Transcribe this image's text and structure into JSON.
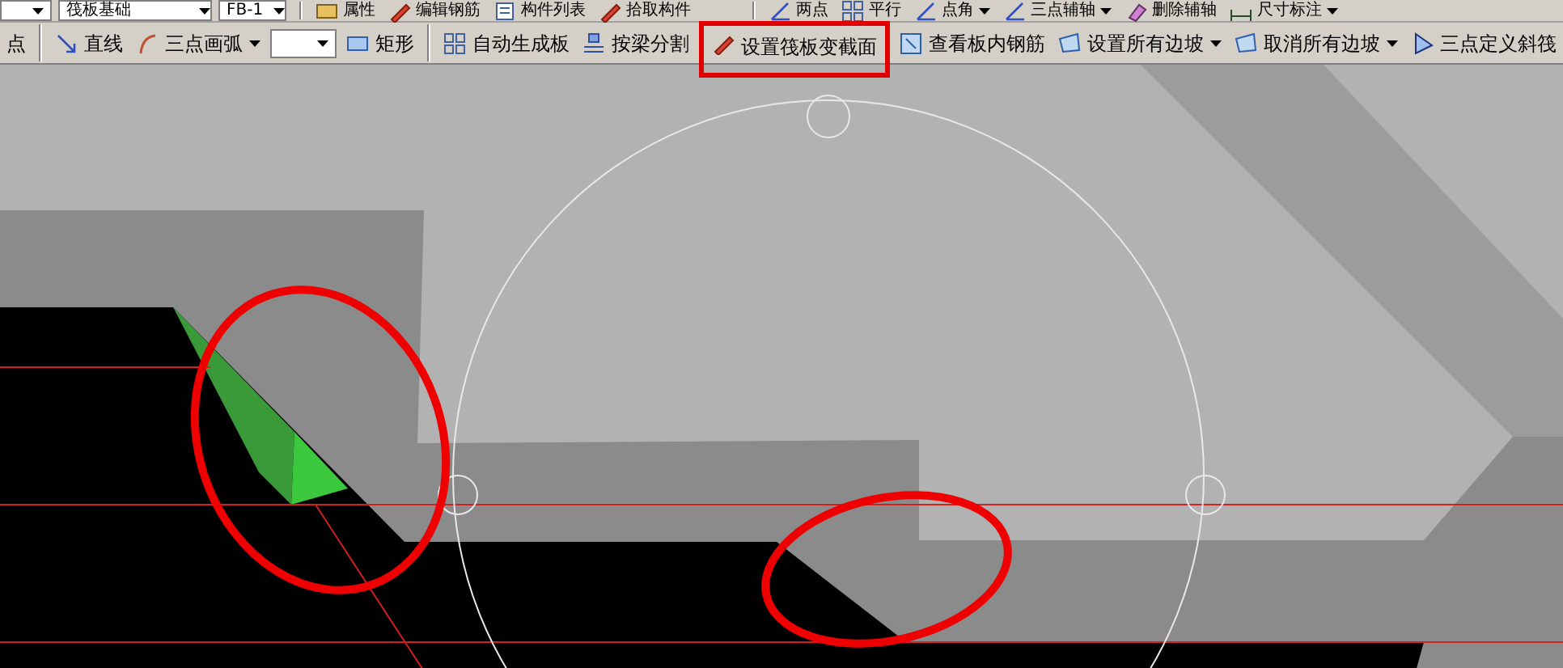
{
  "toolbar_top": {
    "combos": [
      {
        "value": "筏板基础"
      },
      {
        "value": "FB-1"
      }
    ],
    "groups": [
      [
        {
          "label": "属性",
          "caret": false
        },
        {
          "label": "编辑钢筋",
          "caret": false
        },
        {
          "label": "构件列表",
          "caret": false
        },
        {
          "label": "拾取构件",
          "caret": false
        }
      ],
      [
        {
          "label": "两点",
          "caret": false
        },
        {
          "label": "平行",
          "caret": false
        },
        {
          "label": "点角",
          "caret": true
        },
        {
          "label": "三点辅轴",
          "caret": true
        },
        {
          "label": "删除辅轴",
          "caret": false
        },
        {
          "label": "尺寸标注",
          "caret": true
        }
      ]
    ]
  },
  "toolbar_main": {
    "groups": [
      [
        {
          "kind": "button",
          "label": "点",
          "caret": false,
          "highlighted": false
        }
      ],
      [
        {
          "kind": "button",
          "label": "直线",
          "caret": false,
          "highlighted": false
        },
        {
          "kind": "button",
          "label": "三点画弧",
          "caret": true,
          "highlighted": false
        },
        {
          "kind": "combo",
          "caret": true
        },
        {
          "kind": "button",
          "label": "矩形",
          "caret": false,
          "highlighted": false
        }
      ],
      [
        {
          "kind": "button",
          "label": "自动生成板",
          "caret": false,
          "highlighted": false
        },
        {
          "kind": "button",
          "label": "按梁分割",
          "caret": false,
          "highlighted": false
        },
        {
          "kind": "button",
          "label": "设置筏板变截面",
          "caret": false,
          "highlighted": true
        },
        {
          "kind": "button",
          "label": "查看板内钢筋",
          "caret": false,
          "highlighted": false
        },
        {
          "kind": "button",
          "label": "设置所有边坡",
          "caret": true,
          "highlighted": false
        },
        {
          "kind": "button",
          "label": "取消所有边坡",
          "caret": true,
          "highlighted": false
        },
        {
          "kind": "button",
          "label": "三点定义斜筏",
          "caret": false,
          "highlighted": false
        }
      ]
    ]
  }
}
